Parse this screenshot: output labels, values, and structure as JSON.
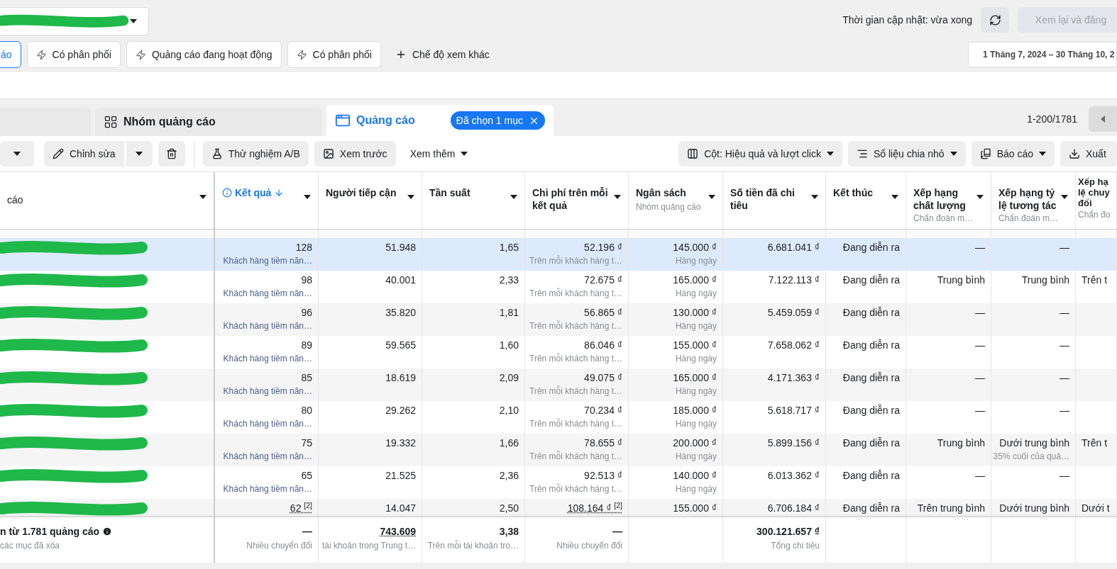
{
  "header": {
    "update_time": "Thời gian cập nhật: vừa xong",
    "review_button": {
      "label": "Xem lại và đăng",
      "disabled": true
    },
    "date_range": "1 Tháng 7, 2024 – 30 Tháng 10, 2"
  },
  "filters": [
    {
      "label": "áo",
      "selected": true
    },
    {
      "label": "Có phân phối",
      "selected": false
    },
    {
      "label": "Quảng cáo đang hoạt động",
      "selected": false
    },
    {
      "label": "Có phân phối",
      "selected": false
    }
  ],
  "more_views": "Chế độ xem khác",
  "tabs": [
    {
      "label": "Nhóm quảng cáo",
      "selected": false
    },
    {
      "label": "Quảng cáo",
      "selected": true,
      "badge": "Đã chọn 1 mục"
    }
  ],
  "pagination": "1-200/1781",
  "toolbar_left": [
    "Chỉnh sửa",
    "Thử nghiệm A/B",
    "Xem trước",
    "Xem thêm"
  ],
  "toolbar_right": [
    {
      "label": "Cột: Hiệu quả và lượt click",
      "caret": true
    },
    {
      "label": "Số liệu chia nhỏ",
      "caret": true
    },
    {
      "label": "Báo cáo",
      "caret": true
    },
    {
      "label": "Xuất",
      "caret": false
    }
  ],
  "columns": [
    {
      "label": "cáo",
      "kind": "name",
      "total": {
        "text": "n từ 1.781 quảng cáo",
        "sub": "các mục đã xóa",
        "info": true
      }
    },
    {
      "label": "Kết quả",
      "kind": "results",
      "sorted": true,
      "total": {
        "text": "—",
        "sub": "Nhiều chuyển đổi"
      }
    },
    {
      "label": "Người tiếp cận",
      "kind": "metric",
      "sorted": false,
      "total": {
        "text": "743.609",
        "sub": "tài khoản trong Trung t…",
        "dotted": true
      }
    },
    {
      "label": "Tần suất",
      "kind": "metric",
      "sorted": false,
      "total": {
        "text": "3,38",
        "sub": "Trên mỗi tài khoản tro…"
      }
    },
    {
      "label": "Chi phí trên mỗi kết quả",
      "kind": "metric",
      "sorted": false,
      "total": {
        "text": "—",
        "sub": "Nhiều chuyển đổi"
      }
    },
    {
      "label": "Ngân sách",
      "sub": "Nhóm quảng cáo",
      "kind": "metric",
      "sorted": false
    },
    {
      "label": "Số tiền đã chi tiêu",
      "kind": "metric",
      "sorted": false,
      "total": {
        "text": "300.121.657 ₫",
        "sub": "Tổng chi tiêu"
      }
    },
    {
      "label": "Kết thúc",
      "kind": "metric",
      "sorted": false
    },
    {
      "label": "Xếp hạng chất lượng",
      "sub": "Chẩn đoán m…",
      "kind": "metric",
      "sorted": false
    },
    {
      "label": "Xếp hạng tỷ lệ tương tác",
      "sub": "Chẩn đoán m…",
      "kind": "metric",
      "sorted": false
    },
    {
      "label": "Xếp hạ lệ chuy đổi",
      "sub": "Chẩn đo",
      "kind": "metric",
      "sorted": false
    }
  ],
  "rows": [
    {
      "selected": true,
      "cells": [
        {
          "text": "128",
          "sub": "Khách hàng tiềm năn…"
        },
        {
          "text": "51.948"
        },
        {
          "text": "1,65"
        },
        {
          "text": "52.196 ₫",
          "sub": "Trên mỗi khách hàng t…"
        },
        {
          "text": "145.000 ₫",
          "sub": "Hàng ngày"
        },
        {
          "text": "6.681.041 ₫"
        },
        {
          "text": "Đang diễn ra"
        },
        {
          "text": "—"
        },
        {
          "text": "—"
        }
      ]
    },
    {
      "selected": false,
      "cells": [
        {
          "text": "98",
          "sub": "Khách hàng tiềm năn…"
        },
        {
          "text": "40.001"
        },
        {
          "text": "2,33"
        },
        {
          "text": "72.675 ₫",
          "sub": "Trên mỗi khách hàng t…"
        },
        {
          "text": "165.000 ₫",
          "sub": "Hàng ngày"
        },
        {
          "text": "7.122.113 ₫"
        },
        {
          "text": "Đang diễn ra"
        },
        {
          "text": "Trung bình"
        },
        {
          "text": "Trung bình"
        },
        {
          "text": "Trên t"
        }
      ]
    },
    {
      "selected": false,
      "cells": [
        {
          "text": "96",
          "sub": "Khách hàng tiềm năn…"
        },
        {
          "text": "35.820"
        },
        {
          "text": "1,81"
        },
        {
          "text": "56.865 ₫",
          "sub": "Trên mỗi khách hàng t…"
        },
        {
          "text": "130.000 ₫",
          "sub": "Hàng ngày"
        },
        {
          "text": "5.459.059 ₫"
        },
        {
          "text": "Đang diễn ra"
        },
        {
          "text": "—"
        },
        {
          "text": "—"
        }
      ]
    },
    {
      "selected": false,
      "cells": [
        {
          "text": "89",
          "sub": "Khách hàng tiềm năn…"
        },
        {
          "text": "59.565"
        },
        {
          "text": "1,60"
        },
        {
          "text": "86.046 ₫",
          "sub": "Trên mỗi khách hàng t…"
        },
        {
          "text": "155.000 ₫",
          "sub": "Hàng ngày"
        },
        {
          "text": "7.658.062 ₫"
        },
        {
          "text": "Đang diễn ra"
        },
        {
          "text": "—"
        },
        {
          "text": "—"
        }
      ]
    },
    {
      "selected": false,
      "cells": [
        {
          "text": "85",
          "sub": "Khách hàng tiềm năn…"
        },
        {
          "text": "18.619"
        },
        {
          "text": "2,09"
        },
        {
          "text": "49.075 ₫",
          "sub": "Trên mỗi khách hàng t…"
        },
        {
          "text": "165.000 ₫",
          "sub": "Hàng ngày"
        },
        {
          "text": "4.171.363 ₫"
        },
        {
          "text": "Đang diễn ra"
        },
        {
          "text": "—"
        },
        {
          "text": "—"
        }
      ]
    },
    {
      "selected": false,
      "cells": [
        {
          "text": "80",
          "sub": "Khách hàng tiềm năn…"
        },
        {
          "text": "29.262"
        },
        {
          "text": "2,10"
        },
        {
          "text": "70.234 ₫",
          "sub": "Trên mỗi khách hàng t…"
        },
        {
          "text": "185.000 ₫",
          "sub": "Hàng ngày"
        },
        {
          "text": "5.618.717 ₫"
        },
        {
          "text": "Đang diễn ra"
        },
        {
          "text": "—"
        },
        {
          "text": "—"
        }
      ]
    },
    {
      "selected": false,
      "cells": [
        {
          "text": "75",
          "sub": "Khách hàng tiềm năn…"
        },
        {
          "text": "19.332"
        },
        {
          "text": "1,66"
        },
        {
          "text": "78.655 ₫",
          "sub": "Trên mỗi khách hàng t…"
        },
        {
          "text": "200.000 ₫",
          "sub": "Hàng ngày"
        },
        {
          "text": "5.899.156 ₫"
        },
        {
          "text": "Đang diễn ra"
        },
        {
          "text": "Trung bình"
        },
        {
          "text": "Dưới trung bình",
          "sub": "35% cuối của quả…"
        },
        {
          "text": "Trên t"
        }
      ]
    },
    {
      "selected": false,
      "cells": [
        {
          "text": "65",
          "sub": "Khách hàng tiềm năn…"
        },
        {
          "text": "21.525"
        },
        {
          "text": "2,36"
        },
        {
          "text": "92.513 ₫",
          "sub": "Trên mỗi khách hàng t…"
        },
        {
          "text": "140.000 ₫",
          "sub": "Hàng ngày"
        },
        {
          "text": "6.013.362 ₫"
        },
        {
          "text": "Đang diễn ra"
        },
        {
          "text": "—"
        },
        {
          "text": "—"
        }
      ]
    },
    {
      "selected": false,
      "cells": [
        {
          "text": "62 $^{[2]}$",
          "dotted": true
        },
        {
          "text": "14.047"
        },
        {
          "text": "2,50"
        },
        {
          "text": "108.164 ₫ $^{[2]}$",
          "dotted": true
        },
        {
          "text": "155.000 ₫"
        },
        {
          "text": "6.706.184 ₫"
        },
        {
          "text": "Đang diễn ra"
        },
        {
          "text": "Trên trung bình"
        },
        {
          "text": "Dưới trung bình"
        },
        {
          "text": "Dưới t"
        }
      ]
    }
  ]
}
